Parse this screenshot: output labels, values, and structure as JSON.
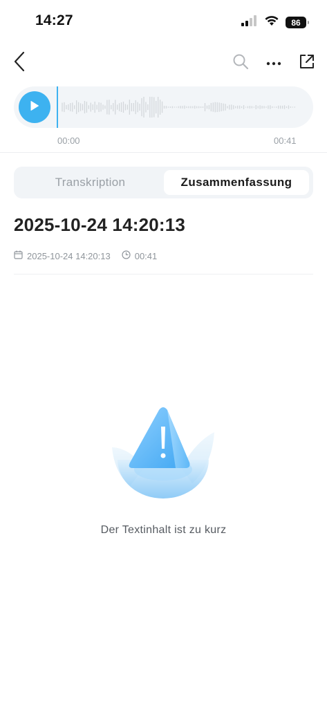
{
  "status_bar": {
    "time": "14:27",
    "battery": "86"
  },
  "nav": {
    "back_icon": "chevron-left-icon",
    "search_icon": "search-icon",
    "more_icon": "ellipsis-icon",
    "share_icon": "share-icon"
  },
  "player": {
    "current_time": "00:00",
    "total_time": "00:41",
    "accent_color": "#3db2f0"
  },
  "tabs": [
    {
      "label": "Transkription",
      "active": false
    },
    {
      "label": "Zusammenfassung",
      "active": true
    }
  ],
  "record": {
    "title": "2025-10-24 14:20:13",
    "date": "2025-10-24 14:20:13",
    "duration": "00:41"
  },
  "empty_state": {
    "message": "Der Textinhalt ist zu kurz",
    "icon": "warning-triangle-icon"
  }
}
